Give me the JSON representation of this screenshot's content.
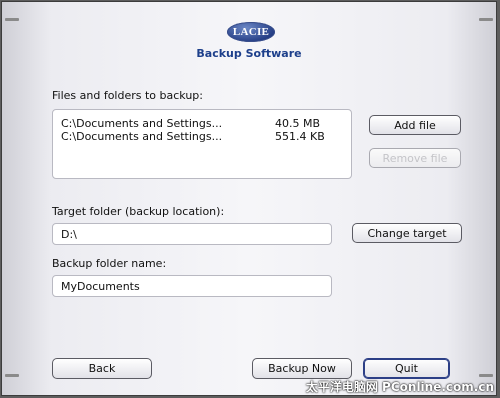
{
  "logo": {
    "text": "LACIE"
  },
  "app_title": "Backup Software",
  "files_section": {
    "label": "Files and folders to backup:",
    "files": [
      {
        "name": "C:\\Documents and Settings...",
        "size": "40.5 MB"
      },
      {
        "name": "C:\\Documents and Settings...",
        "size": "551.4 KB"
      }
    ],
    "add_label": "Add file",
    "remove_label": "Remove file"
  },
  "target_section": {
    "label": "Target folder (backup location):",
    "value": "D:\\",
    "change_label": "Change target"
  },
  "backup_name_section": {
    "label": "Backup folder name:",
    "value": "MyDocuments"
  },
  "footer": {
    "back_label": "Back",
    "backup_now_label": "Backup Now",
    "quit_label": "Quit"
  },
  "watermark": "太平洋电脑网 PConline.com.cn",
  "colors": {
    "accent": "#1d3f8b",
    "logo": "#263f86",
    "background": "#f3f3f6"
  }
}
